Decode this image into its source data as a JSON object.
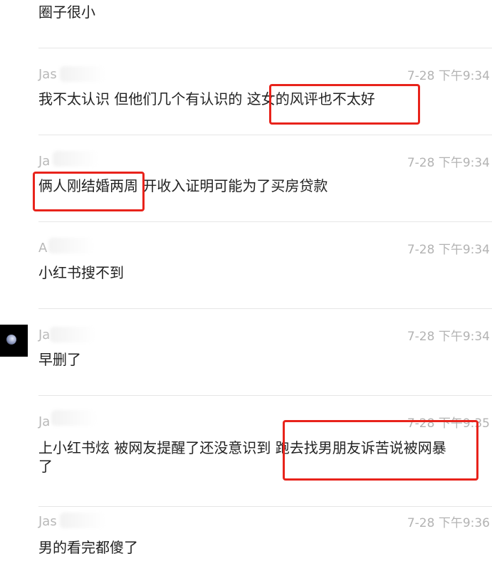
{
  "messages": [
    {
      "name": "",
      "time": "",
      "text": "圈子很小"
    },
    {
      "name": "Jas",
      "time": "7-28 下午9:34",
      "text": "我不太认识 但他们几个有认识的 这女的风评也不太好"
    },
    {
      "name": "Ja",
      "time": "7-28 下午9:34",
      "text": "俩人刚结婚两周 开收入证明可能为了买房贷款"
    },
    {
      "name": "A",
      "time": "7-28 下午9:34",
      "text": "小红书搜不到"
    },
    {
      "name": "Ja",
      "time": "7-28 下午9:34",
      "text": "早删了"
    },
    {
      "name": "Ja",
      "time": "7-28 下午9:35",
      "text_line1": "上小红书炫 被网友提醒了还没意识到 跑去找男朋友诉苦说被网暴",
      "text_line2": "了"
    },
    {
      "name": "Jas",
      "time": "7-28 下午9:36",
      "text": "男的看完都傻了"
    }
  ],
  "highlight_color": "#e8231b",
  "avatar_icon": "moon-avatar-icon"
}
